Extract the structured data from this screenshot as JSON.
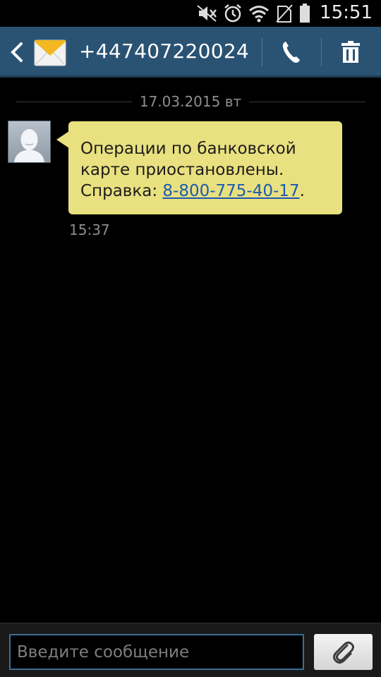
{
  "status_bar": {
    "time": "15:51",
    "icons": [
      "mute-icon",
      "alarm-icon",
      "wifi-icon",
      "no-sim-icon",
      "battery-icon"
    ]
  },
  "header": {
    "contact_number": "+447407220024",
    "icons": [
      "back-arrow-icon",
      "envelope-icon",
      "phone-icon",
      "trash-icon"
    ],
    "colors": {
      "background": "#2a5273"
    }
  },
  "conversation": {
    "date_separator": "17.03.2015 вт",
    "messages": [
      {
        "direction": "incoming",
        "text_line1": "Операции по банковской",
        "text_line2": "карте приостановлены.",
        "text_prefix": "Справка: ",
        "phone_link": "8-800-775-40-17",
        "text_suffix": ".",
        "time": "15:37",
        "bubble_color": "#e9e07f"
      }
    ]
  },
  "composer": {
    "placeholder": "Введите сообщение",
    "value": "",
    "attach_icon": "paperclip-icon"
  }
}
